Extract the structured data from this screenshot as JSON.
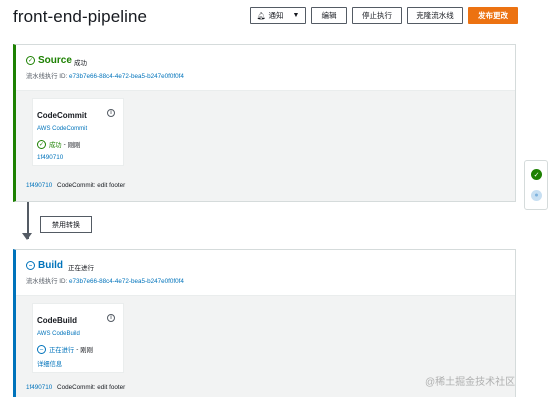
{
  "header": {
    "title": "front-end-pipeline",
    "buttons": {
      "notify": "通知",
      "edit": "编辑",
      "stop": "停止执行",
      "clone": "克隆流水线",
      "release": "发布更改"
    }
  },
  "stages": [
    {
      "name": "Source",
      "status": "成功",
      "exec_label": "流水线执行 ID:",
      "exec_id": "e73b7e66-88c4-4e72-bea5-b247e0f0f0f4",
      "action": {
        "name": "CodeCommit",
        "provider": "AWS CodeCommit",
        "status": "成功",
        "separator": "-",
        "when": "刚刚",
        "sub": "1f490710"
      },
      "footer": {
        "commit": "1f490710",
        "message": "CodeCommit: edit footer"
      }
    },
    {
      "name": "Build",
      "status": "正在进行",
      "exec_label": "流水线执行 ID:",
      "exec_id": "e73b7e66-88c4-4e72-bea5-b247e0f0f0f4",
      "action": {
        "name": "CodeBuild",
        "provider": "AWS CodeBuild",
        "status": "正在进行",
        "separator": "-",
        "when": "刚刚",
        "sub": "详细信息"
      },
      "footer": {
        "commit": "1f490710",
        "message": "CodeCommit: edit footer"
      }
    }
  ],
  "transition": {
    "disable_label": "禁用转换"
  },
  "watermark": "@稀土掘金技术社区",
  "colors": {
    "success": "#1d8102",
    "in_progress": "#0073bb",
    "primary": "#ec7211"
  },
  "icons": {
    "notify": "bell-icon",
    "success": "check-circle-icon",
    "in_progress": "progress-circle-icon",
    "info": "info-icon"
  }
}
